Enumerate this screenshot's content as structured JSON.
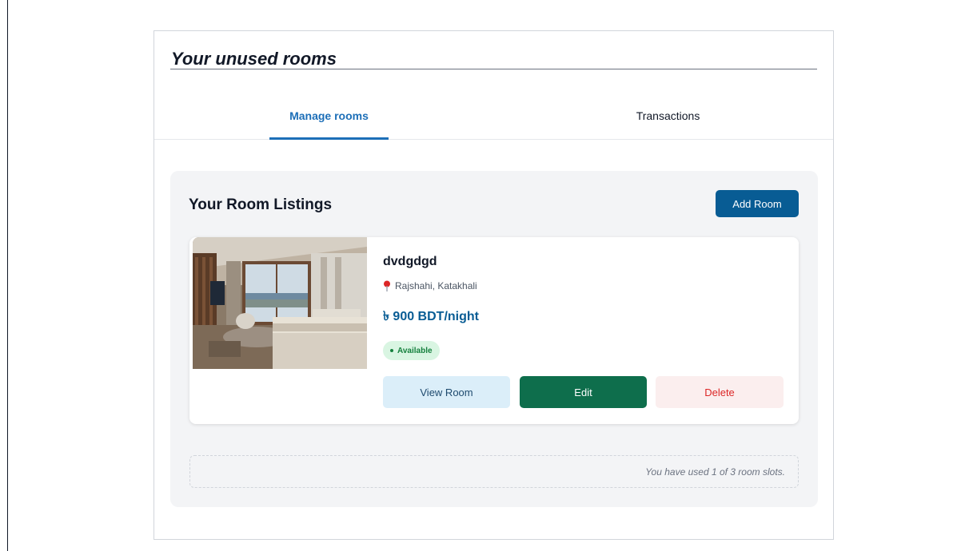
{
  "panel": {
    "title": "Your unused rooms"
  },
  "tabs": [
    {
      "label": "Manage rooms",
      "active": true
    },
    {
      "label": "Transactions",
      "active": false
    }
  ],
  "listings": {
    "title": "Your Room Listings",
    "add_button": "Add Room",
    "rooms": [
      {
        "name": "dvdgdgd",
        "location": "Rajshahi, Katakhali",
        "price": "৳ 900 BDT/night",
        "status": "Available",
        "actions": {
          "view": "View Room",
          "edit": "Edit",
          "delete": "Delete"
        }
      }
    ]
  },
  "slots_note": "You have used 1 of 3 room slots.",
  "colors": {
    "accent": "#1d6fb8",
    "primary_button": "#085c94",
    "edit": "#0e6e4c",
    "delete_text": "#dc2626",
    "available": "#15803d"
  },
  "icons": {
    "location": "map-pin-icon"
  }
}
